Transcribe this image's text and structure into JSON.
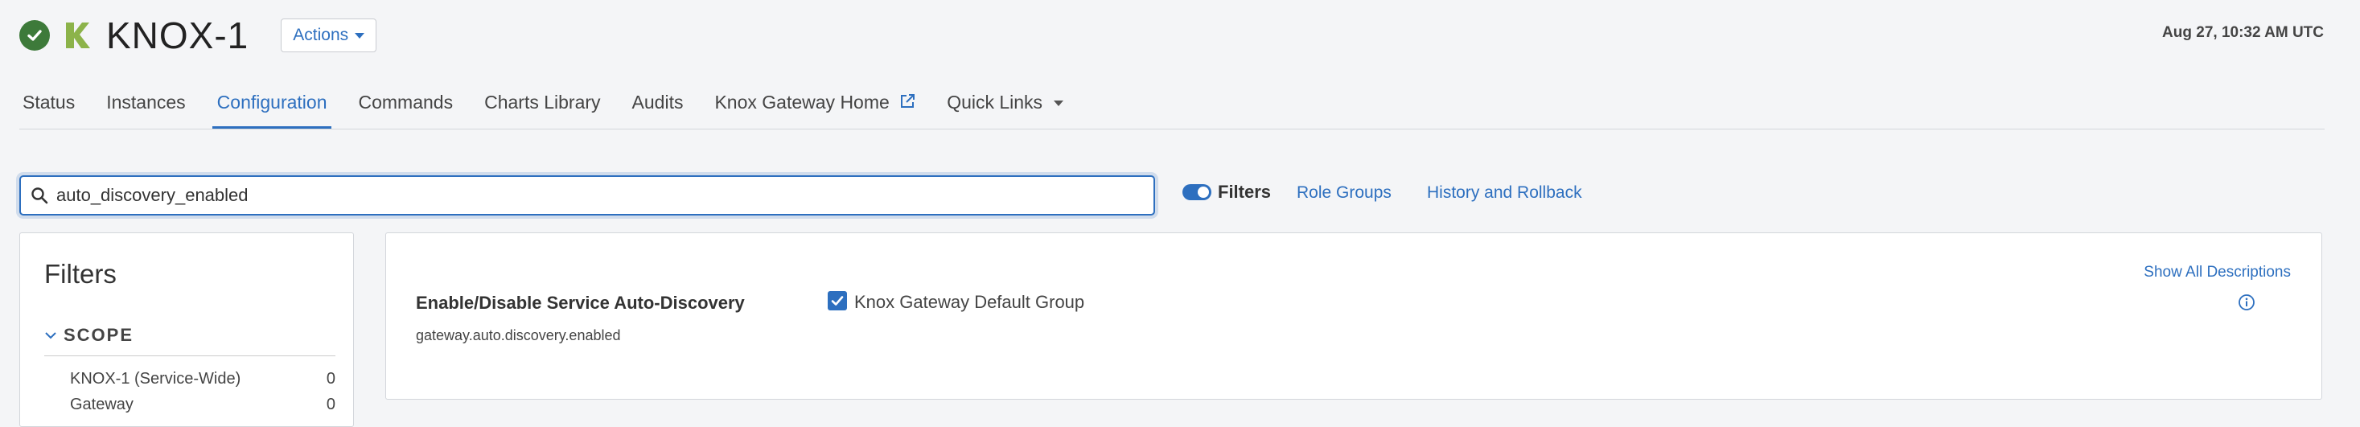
{
  "header": {
    "service_name": "KNOX-1",
    "actions_label": "Actions",
    "timestamp": "Aug 27, 10:32 AM UTC",
    "status_icon": "check-circle-icon",
    "logo_icon": "knox-k-logo"
  },
  "tabs": [
    {
      "label": "Status"
    },
    {
      "label": "Instances"
    },
    {
      "label": "Configuration"
    },
    {
      "label": "Commands"
    },
    {
      "label": "Charts Library"
    },
    {
      "label": "Audits"
    },
    {
      "label": "Knox Gateway Home"
    },
    {
      "label": "Quick Links"
    }
  ],
  "search": {
    "value": "auto_discovery_enabled"
  },
  "toolbar": {
    "filters_label": "Filters",
    "role_groups_label": "Role Groups",
    "history_label": "History and Rollback"
  },
  "filters_panel": {
    "title": "Filters",
    "scope_label": "SCOPE",
    "scope_items": [
      {
        "label": "KNOX-1 (Service-Wide)",
        "count": "0"
      },
      {
        "label": "Gateway",
        "count": "0"
      }
    ]
  },
  "config": {
    "show_all_descriptions": "Show All Descriptions",
    "property": {
      "display_name": "Enable/Disable Service Auto-Discovery",
      "key": "gateway.auto.discovery.enabled",
      "group_label": "Knox Gateway Default Group",
      "checked": true
    }
  },
  "colors": {
    "accent": "#2d6fbf",
    "status_ok": "#3d7a3a",
    "logo_green": "#8cb34a"
  }
}
